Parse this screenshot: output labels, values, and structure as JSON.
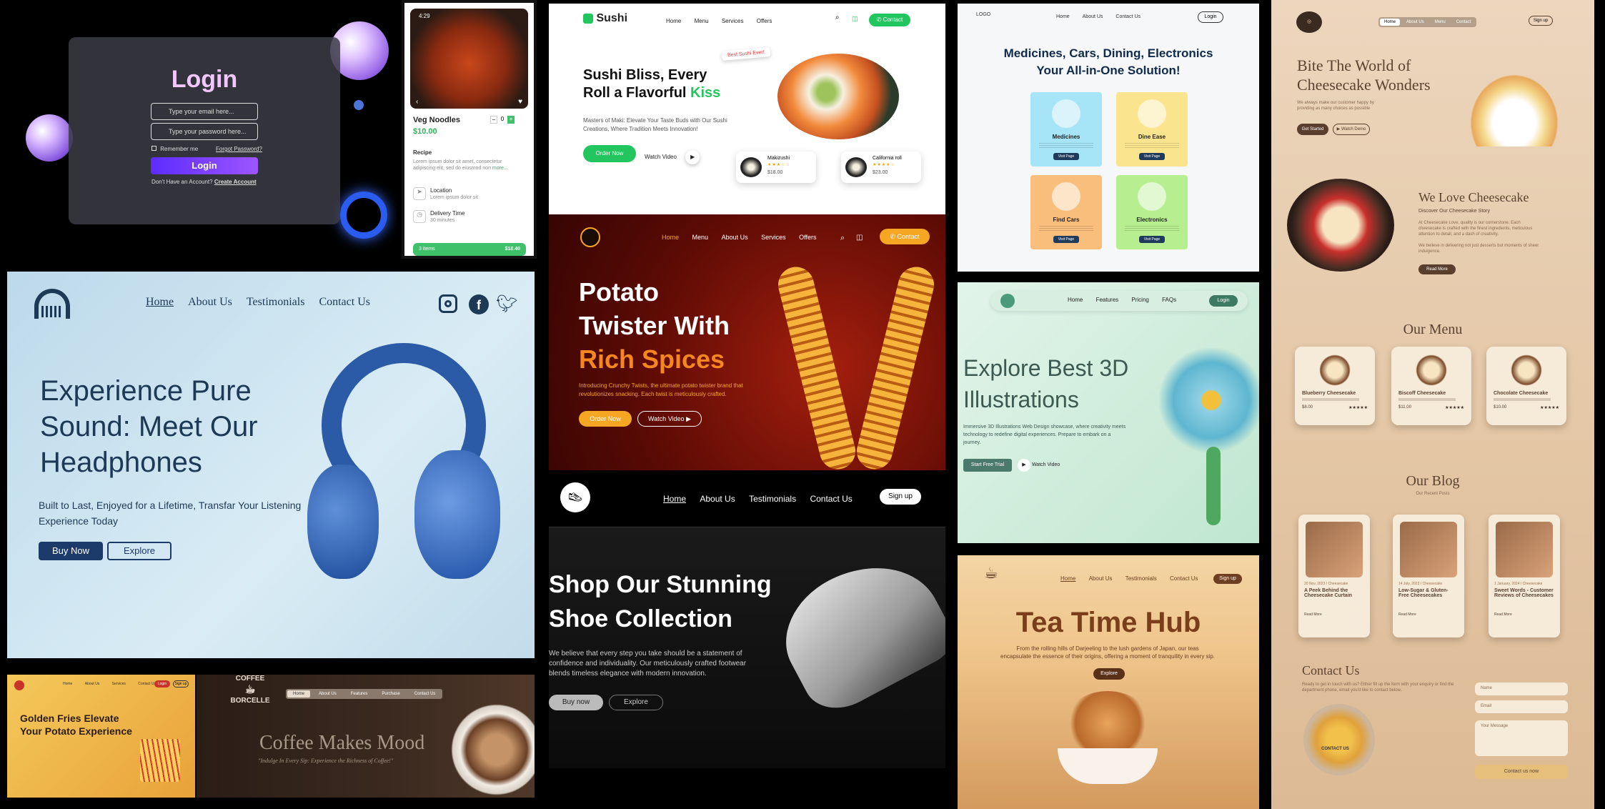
{
  "login": {
    "title": "Login",
    "email_placeholder": "Type your email here...",
    "password_placeholder": "Type your password here...",
    "remember": "Remember me",
    "forgot": "Forgot Password?",
    "button": "Login",
    "no_account": "Don't Have an Account?",
    "create": "Create Account"
  },
  "noodles": {
    "time": "4:29",
    "name": "Veg Noodles",
    "price": "$10.00",
    "qty": "0",
    "recipe_label": "Recipe",
    "recipe_text": "Lorem ipsum dolor sit amet, consectetur adipiscing elit, sed do eiusmod non",
    "more": "more...",
    "location_label": "Location",
    "location_text": "Lorem ipsum dolor sit",
    "delivery_label": "Delivery Time",
    "delivery_text": "30 minutes",
    "cart_items": "3 items",
    "cart_total": "$18.40"
  },
  "sushi": {
    "logo": "Sushi",
    "nav": [
      "Home",
      "Menu",
      "Services",
      "Offers"
    ],
    "contact": "Contact",
    "badge": "Best Sushi Ever!",
    "title_1": "Sushi Bliss, Every",
    "title_2": "Roll a Flavorful",
    "title_accent": "Kiss",
    "subtitle": "Masters of Maki: Elevate Your Taste Buds with Our Sushi Creations, Where Tradition Meets Innovation!",
    "order": "Order Now",
    "watch": "Watch Video",
    "items": [
      {
        "name": "Makizushi",
        "price": "$18.00"
      },
      {
        "name": "California roll",
        "price": "$23.00"
      }
    ]
  },
  "medicines": {
    "logo": "LOGO",
    "nav": [
      "Home",
      "About Us",
      "Contact Us"
    ],
    "login": "Login",
    "title_1": "Medicines, Cars, Dining, Electronics",
    "title_2": "Your All-in-One Solution!",
    "cards": [
      {
        "name": "Medicines",
        "color": "#a6e4f7",
        "btn": "Visit Page"
      },
      {
        "name": "Dine Ease",
        "color": "#fbe48e",
        "btn": "Visit Page"
      },
      {
        "name": "Find Cars",
        "color": "#f9bd7c",
        "btn": "Visit Page"
      },
      {
        "name": "Electronics",
        "color": "#b7ee8f",
        "btn": "Visit Page"
      }
    ]
  },
  "cheesecake": {
    "nav": [
      "Home",
      "About Us",
      "Menu",
      "Contact"
    ],
    "signup": "Sign up",
    "hero_1": "Bite The World of",
    "hero_2": "Cheesecake Wonders",
    "hero_text": "We always make our customer happy by providing as many choices as possible",
    "get_started": "Get Started",
    "watch": "Watch Demo",
    "love_title": "We Love Cheesecake",
    "love_sub": "Discover Our Cheesecake Story",
    "love_p1": "At Cheesecake Love, quality is our cornerstone. Each cheesecake is crafted with the finest ingredients, meticulous attention to detail, and a dash of creativity.",
    "love_p2": "We believe in delivering not just desserts but moments of sheer indulgence.",
    "read_more": "Read More",
    "menu_title": "Our Menu",
    "menu": [
      {
        "name": "Blueberry Cheesecake",
        "price": "$8.00"
      },
      {
        "name": "Biscoff Cheesecake",
        "price": "$11.00"
      },
      {
        "name": "Chocolate Cheesecake",
        "price": "$10.00"
      }
    ],
    "blog_title": "Our Blog",
    "blog_sub": "Our Recent Posts",
    "blog": [
      {
        "date": "20 Nov, 2023 / Cheesecake",
        "title": "A Peek Behind the Cheesecake Curtain",
        "link": "Read More"
      },
      {
        "date": "14 July, 2023 / Cheesecake",
        "title": "Low-Sugar & Gluten-Free Cheesecakes",
        "link": "Read More"
      },
      {
        "date": "1 January, 2024 / Cheesecake",
        "title": "Sweet Words - Customer Reviews of Cheesecakes",
        "link": "Read More"
      }
    ],
    "contact_title": "Contact Us",
    "contact_text": "Ready to get in touch with us? Either fill up the form with your enquiry or find the department phone, email you'd like to contact below.",
    "name_ph": "Name",
    "email_ph": "Email",
    "msg_ph": "Your Message",
    "contact_btn": "Contact us now",
    "contact_img_label": "CONTACT US"
  },
  "headphones": {
    "nav": [
      "Home",
      "About Us",
      "Testimonials",
      "Contact Us"
    ],
    "title_1": "Experience Pure",
    "title_2": "Sound: Meet Our",
    "title_3": "Headphones",
    "subtitle": "Built to Last, Enjoyed for a Lifetime, Transfar Your Listening Experience Today",
    "buy": "Buy Now",
    "explore": "Explore"
  },
  "potato": {
    "nav": [
      "Home",
      "Menu",
      "About Us",
      "Services",
      "Offers"
    ],
    "contact": "Contact",
    "title_1": "Potato",
    "title_2": "Twister With",
    "title_accent": "Rich Spices",
    "subtitle": "Introducing Crunchy Twists, the ultimate potato twister brand that revolutionizes snacking. Each twist is meticulously crafted.",
    "order": "Order Now",
    "watch": "Watch Video"
  },
  "illustrations": {
    "nav": [
      "Home",
      "Features",
      "Pricing",
      "FAQs"
    ],
    "login": "Login",
    "title_1": "Explore Best 3D",
    "title_2": "Illustrations",
    "subtitle": "Immersive 3D Illustrations Web Design showcase, where creativity meets technology to redefine digital experiences. Prepare to embark on a journey.",
    "trial": "Start Free Trial",
    "watch": "Watch Video"
  },
  "shoes": {
    "nav": [
      "Home",
      "About Us",
      "Testimonials",
      "Contact Us"
    ],
    "signup": "Sign up",
    "title_1": "Shop Our Stunning",
    "title_2": "Shoe Collection",
    "subtitle": "We believe that every step you take should be a statement of confidence and individuality. Our meticulously crafted footwear blends timeless elegance with modern innovation.",
    "buy": "Buy now",
    "explore": "Explore"
  },
  "tea": {
    "nav": [
      "Home",
      "About Us",
      "Testimonials",
      "Contact Us"
    ],
    "signup": "Sign up",
    "title": "Tea Time Hub",
    "subtitle": "From the rolling hills of Darjeeling to the lush gardens of Japan, our teas encapsulate the essence of their origins, offering a moment of tranquility in every sip.",
    "explore": "Explore"
  },
  "fries": {
    "nav": [
      "Home",
      "About Us",
      "Services",
      "Contact Us"
    ],
    "login": "Login",
    "signup": "Sign up",
    "title_1": "Golden Fries Elevate",
    "title_2": "Your Potato Experience"
  },
  "coffee": {
    "logo": "BORCELLE",
    "logo_top": "COFFEE",
    "nav": [
      "Home",
      "About Us",
      "Features",
      "Purchase",
      "Contact Us"
    ],
    "title": "Coffee Makes Mood",
    "subtitle": "\"Indulge In Every Sip: Experience the Richness of Coffee!\""
  }
}
